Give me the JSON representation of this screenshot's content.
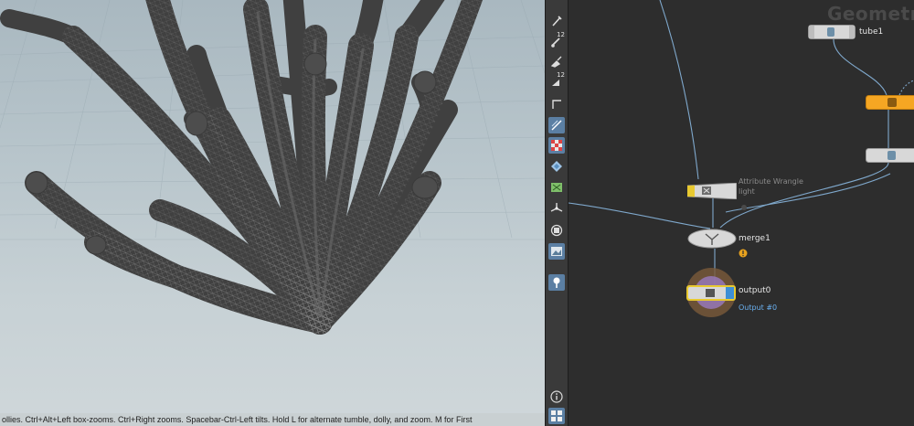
{
  "status_bar": {
    "text": "ollies. Ctrl+Alt+Left box-zooms. Ctrl+Right zooms. Spacebar-Ctrl-Left tilts. Hold L for alternate tumble, dolly, and zoom. M for First"
  },
  "toolbar": {
    "items": [
      {
        "name": "pick-icon",
        "sup": ""
      },
      {
        "name": "point-numbers-icon",
        "sup": "12"
      },
      {
        "name": "brush-icon",
        "sup": ""
      },
      {
        "name": "primitive-numbers-icon",
        "sup": "12"
      },
      {
        "name": "normals-icon",
        "sup": ""
      },
      {
        "name": "snap-grid-icon",
        "sup": ""
      },
      {
        "name": "checker-icon",
        "sup": ""
      },
      {
        "name": "ghost-icon",
        "sup": ""
      },
      {
        "name": "uv-icon",
        "sup": ""
      },
      {
        "name": "transform-handle-icon",
        "sup": ""
      },
      {
        "name": "display-icon",
        "sup": ""
      },
      {
        "name": "camera-view-icon",
        "sup": ""
      },
      {
        "name": "pin-icon",
        "sup": ""
      },
      {
        "name": "info-icon",
        "sup": ""
      },
      {
        "name": "grid-layout-icon",
        "sup": ""
      }
    ]
  },
  "network": {
    "context_title": "Geometr",
    "nodes": {
      "tube1": {
        "label": "tube1"
      },
      "attribwrangle": {
        "label": "Attribute Wrangle",
        "sub": "light"
      },
      "merge1": {
        "label": "merge1"
      },
      "output0": {
        "label": "output0",
        "info": "Output #0"
      }
    },
    "colors": {
      "bypass": "#f5a623",
      "display": "#3d8fd6",
      "template": "#e8c930",
      "wire": "#7fa8cc"
    }
  }
}
